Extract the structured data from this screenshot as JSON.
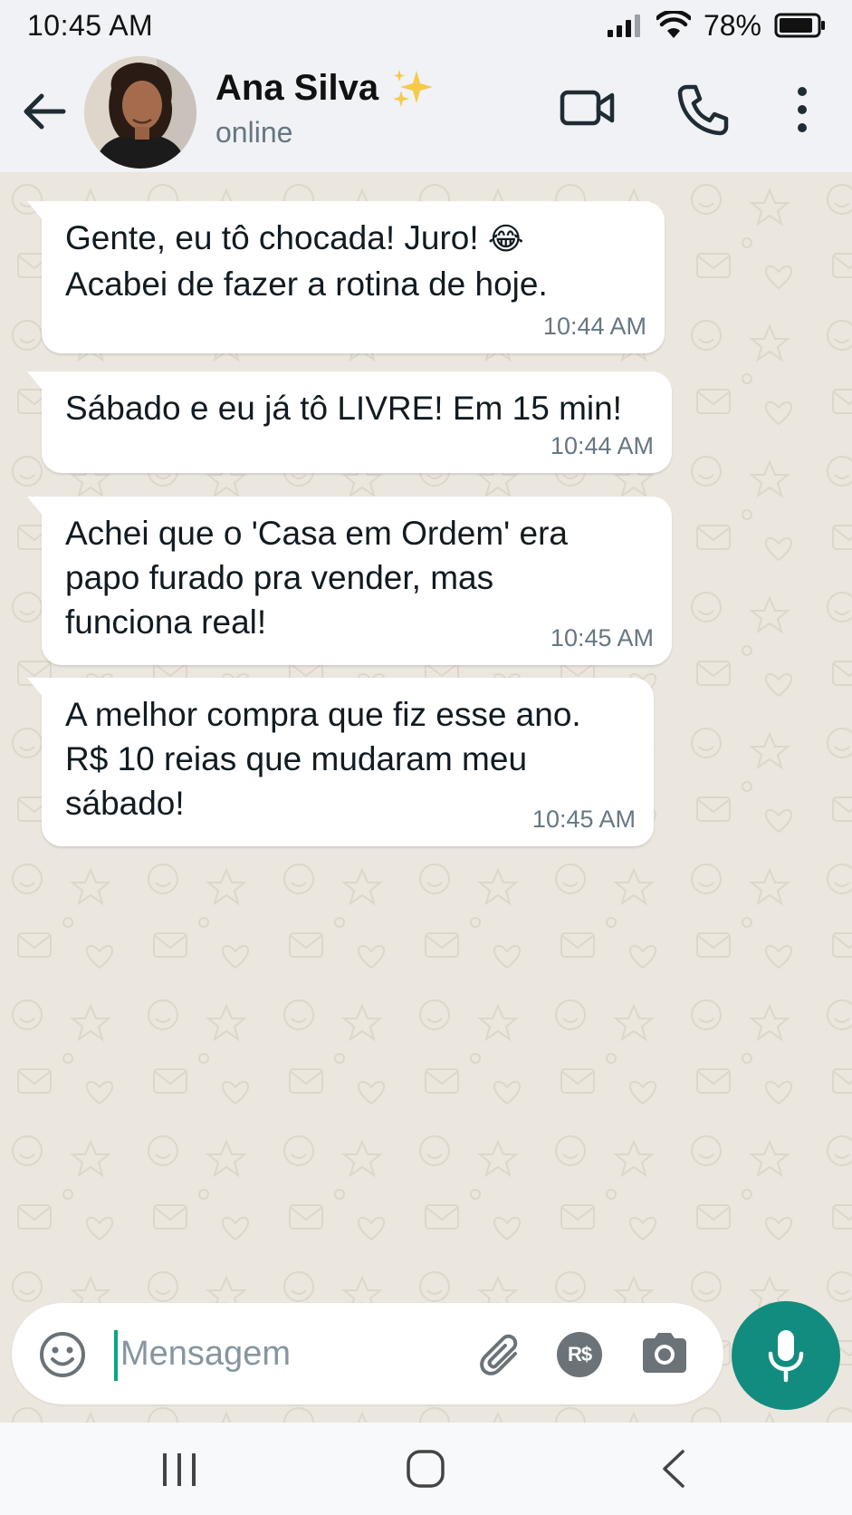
{
  "status_bar": {
    "time": "10:45 AM",
    "battery": "78%",
    "icons": [
      "signal-icon",
      "wifi-icon",
      "battery-icon"
    ]
  },
  "header": {
    "contact_name": "Ana Silva",
    "contact_emoji": "✨",
    "contact_status": "online",
    "icons": [
      "back-arrow-icon",
      "video-call-icon",
      "phone-icon",
      "more-vertical-icon"
    ]
  },
  "messages": [
    {
      "text": "Gente, eu tô chocada! Juro! ",
      "emoji": "😂",
      "text2": "Acabei de fazer a rotina de hoje.",
      "time": "10:44 AM"
    },
    {
      "text": "Sábado e eu já tô LIVRE! Em 15 min!",
      "time": "10:44 AM"
    },
    {
      "text": "Achei que o 'Casa em Ordem' era\npapo furado pra vender, mas\nfunciona real!",
      "time": "10:45 AM"
    },
    {
      "text": "A melhor compra que fiz esse ano.\nR$ 10 reias que mudaram meu\nsábado!",
      "time": "10:45 AM"
    }
  ],
  "composer": {
    "placeholder": "Mensagem",
    "payment_label": "R$",
    "icons": [
      "emoji-icon",
      "attach-icon",
      "payment-icon",
      "camera-icon",
      "mic-icon"
    ]
  },
  "colors": {
    "header_bg": "#f0f2f5",
    "chat_bg": "#ebe6de",
    "bubble_bg": "#ffffff",
    "accent": "#128c7e",
    "cursor": "#00a884"
  },
  "nav_bar": {
    "icons": [
      "recent-apps-icon",
      "home-icon",
      "back-nav-icon"
    ]
  }
}
